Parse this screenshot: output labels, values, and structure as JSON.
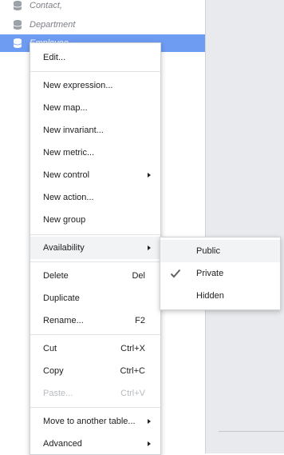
{
  "tree": {
    "items": [
      {
        "label": "Contact,"
      },
      {
        "label": "Department"
      },
      {
        "label": "Employee"
      }
    ]
  },
  "menu": {
    "edit": {
      "label": "Edit..."
    },
    "new_expression": {
      "label": "New expression..."
    },
    "new_map": {
      "label": "New map..."
    },
    "new_invariant": {
      "label": "New invariant..."
    },
    "new_metric": {
      "label": "New metric..."
    },
    "new_control": {
      "label": "New control"
    },
    "new_action": {
      "label": "New action..."
    },
    "new_group": {
      "label": "New group"
    },
    "availability": {
      "label": "Availability"
    },
    "delete": {
      "label": "Delete",
      "shortcut": "Del"
    },
    "duplicate": {
      "label": "Duplicate"
    },
    "rename": {
      "label": "Rename...",
      "shortcut": "F2"
    },
    "cut": {
      "label": "Cut",
      "shortcut": "Ctrl+X"
    },
    "copy": {
      "label": "Copy",
      "shortcut": "Ctrl+C"
    },
    "paste": {
      "label": "Paste...",
      "shortcut": "Ctrl+V",
      "disabled": true
    },
    "move": {
      "label": "Move to another table..."
    },
    "advanced": {
      "label": "Advanced"
    }
  },
  "availability_submenu": {
    "items": [
      {
        "label": "Public"
      },
      {
        "label": "Private",
        "checked": true
      },
      {
        "label": "Hidden"
      }
    ]
  },
  "colors": {
    "selected_row": "#6e9cf3",
    "right_pane": "#e8eaed",
    "disabled_text": "#b8bbc0"
  },
  "icons": {
    "tree_item": "database-icon",
    "submenu_arrow": "chevron-right-icon",
    "checked": "checkmark-icon"
  }
}
